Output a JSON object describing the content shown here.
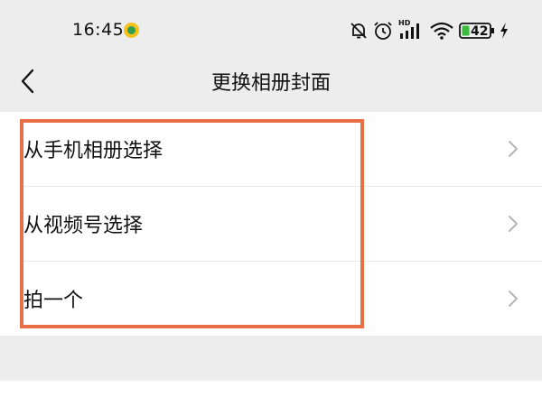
{
  "status_bar": {
    "time": "16:45",
    "battery_level": "42",
    "icons": [
      "app-notification-icon",
      "bell-muted-icon",
      "alarm-icon",
      "hd-signal-icon",
      "wifi-icon",
      "battery-icon",
      "charging-icon"
    ],
    "signal_label": "HD"
  },
  "nav": {
    "title": "更换相册封面",
    "back_icon": "chevron-left-icon"
  },
  "menu": {
    "items": [
      {
        "label": "从手机相册选择"
      },
      {
        "label": "从视频号选择"
      },
      {
        "label": "拍一个"
      }
    ]
  },
  "colors": {
    "background": "#ededed",
    "list_background": "#ffffff",
    "highlight_border": "#e96f45"
  }
}
